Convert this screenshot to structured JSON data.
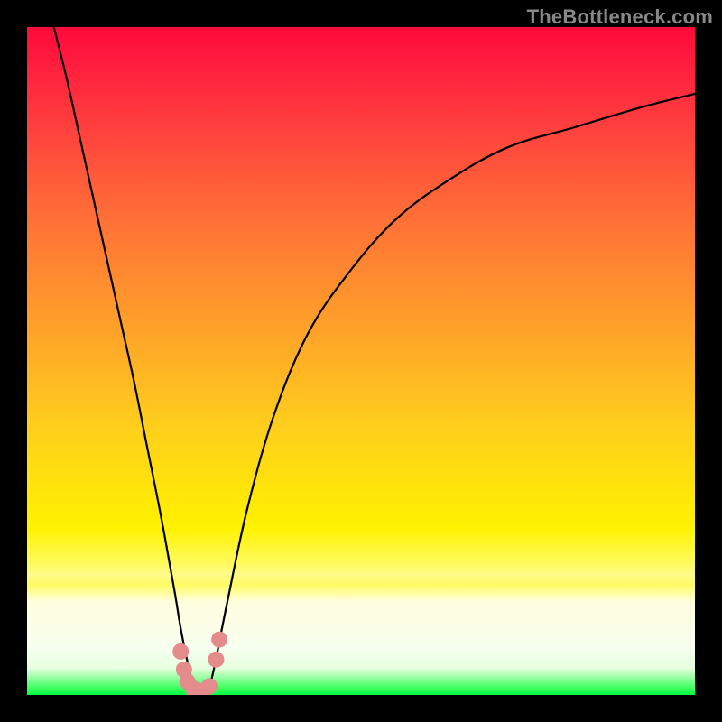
{
  "watermark": "TheBottleneck.com",
  "colors": {
    "frame": "#000000",
    "gradient_top": "#ff0a3a",
    "gradient_mid": "#fff200",
    "gradient_bottom": "#00ff43",
    "curve": "#000000",
    "marker": "#e48b8b"
  },
  "chart_data": {
    "type": "line",
    "title": "",
    "xlabel": "",
    "ylabel": "",
    "xlim": [
      0,
      100
    ],
    "ylim": [
      0,
      100
    ],
    "grid": false,
    "legend": null,
    "note": "Bottleneck / mismatch curve. x≈component-performance ratio (arbitrary 0–100), y≈bottleneck % (0 at bottom, 100 at top). Both branches dip to y≈0 near x≈25 (the sweet spot). Values estimated from pixel positions.",
    "series": [
      {
        "name": "left-branch",
        "x": [
          4,
          6,
          8,
          10,
          12,
          14,
          16,
          18,
          20,
          22,
          23,
          24,
          25,
          26
        ],
        "y": [
          100,
          92,
          83,
          74,
          65,
          56,
          47,
          37,
          27,
          16,
          10,
          5,
          1,
          0
        ]
      },
      {
        "name": "right-branch",
        "x": [
          27,
          28,
          30,
          33,
          37,
          42,
          48,
          55,
          63,
          72,
          82,
          92,
          100
        ],
        "y": [
          0,
          4,
          14,
          28,
          42,
          54,
          63,
          71,
          77,
          82,
          85,
          88,
          90
        ]
      }
    ],
    "markers": {
      "name": "sweet-spot-markers",
      "x": [
        23.0,
        23.5,
        24.0,
        24.8,
        25.6,
        26.4,
        27.3,
        28.3,
        28.8
      ],
      "y": [
        6.5,
        3.8,
        2.0,
        1.0,
        0.6,
        0.6,
        1.3,
        5.3,
        8.3
      ]
    }
  }
}
